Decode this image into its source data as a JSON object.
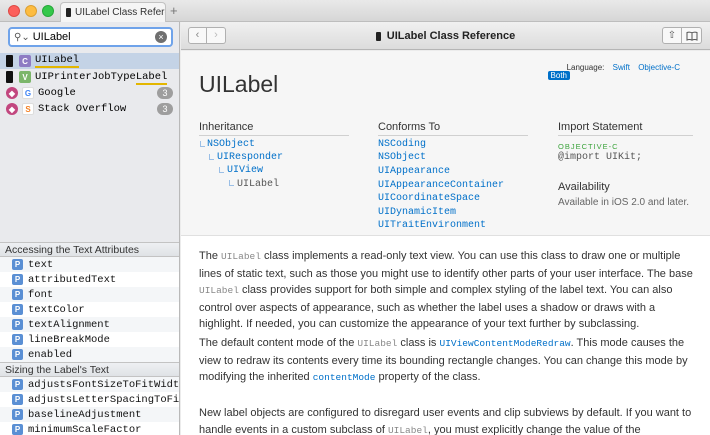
{
  "tab": {
    "title": "UILabel Class Refere",
    "add": "+"
  },
  "search": {
    "value": "UILabel",
    "clear": "×"
  },
  "results": [
    {
      "icon": "C",
      "label": "UILabel",
      "badge": ""
    },
    {
      "icon": "V",
      "label_pre": "UIPrinterJobType",
      "label_hl": "Label",
      "badge": ""
    },
    {
      "icon": "G",
      "label": "Google",
      "badge": "3"
    },
    {
      "icon": "S",
      "label": "Stack Overflow",
      "badge": "3"
    }
  ],
  "sidebar_sections": [
    {
      "title": "Accessing the Text Attributes",
      "items": [
        "text",
        "attributedText",
        "font",
        "textColor",
        "textAlignment",
        "lineBreakMode",
        "enabled"
      ]
    },
    {
      "title": "Sizing the Label's Text",
      "items": [
        "adjustsFontSizeToFitWidth",
        "adjustsLetterSpacingToFitWi…",
        "baselineAdjustment",
        "minimumScaleFactor"
      ]
    }
  ],
  "toolbar": {
    "back": "‹",
    "forward": "›",
    "title": "UILabel Class Reference",
    "share": "⇧",
    "bookmark": "⌂"
  },
  "language": {
    "label": "Language:",
    "swift": "Swift",
    "objc": "Objective-C",
    "both": "Both"
  },
  "doc": {
    "title": "UILabel",
    "inheritance_h": "Inheritance",
    "inheritance": [
      "NSObject",
      "UIResponder",
      "UIView",
      "UILabel"
    ],
    "conforms_h": "Conforms To",
    "conforms": [
      "NSCoding",
      "NSObject",
      "UIAppearance",
      "UIAppearanceContainer",
      "UICoordinateSpace",
      "UIDynamicItem",
      "UITraitEnvironment"
    ],
    "import_h": "Import Statement",
    "import_lang": "OBJECTIVE-C",
    "import_stmt": "@import UIKit;",
    "avail_h": "Availability",
    "avail": "Available in iOS 2.0 and later.",
    "p1_a": "The ",
    "p1_code1": "UILabel",
    "p1_b": " class implements a read-only text view. You can use this class to draw one or multiple lines of static text, such as those you might use to identify other parts of your user interface. The base ",
    "p1_code2": "UILabel",
    "p1_c": " class provides support for both simple and complex styling of the label text. You can also control over aspects of appearance, such as whether the label uses a shadow or draws with a highlight. If needed, you can customize the appearance of your text further by subclassing.",
    "p2_a": "The default content mode of the ",
    "p2_code1": "UILabel",
    "p2_b": " class is ",
    "p2_link1": "UIViewContentModeRedraw",
    "p2_c": ". This mode causes the view to redraw its contents every time its bounding rectangle changes. You can change this mode by modifying the inherited ",
    "p2_link2": "contentMode",
    "p2_d": " property of the class.",
    "p3_a": "New label objects are configured to disregard user events and clip subviews by default. If you want to handle events in a custom subclass of ",
    "p3_code1": "UILabel",
    "p3_b": ", you must explicitly change the value of the"
  },
  "colors": {
    "accent": "#0070c9",
    "selection": "#c4d3e6",
    "highlight": "#e3b600"
  }
}
